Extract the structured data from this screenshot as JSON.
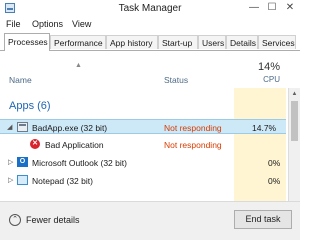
{
  "window": {
    "title": "Task Manager",
    "min": "—",
    "max": "☐",
    "close": "✕"
  },
  "menu": [
    "File",
    "Options",
    "View"
  ],
  "tabs": [
    "Processes",
    "Performance",
    "App history",
    "Start-up",
    "Users",
    "Details",
    "Services"
  ],
  "columns": {
    "name": "Name",
    "status": "Status",
    "cpu_percent": "14%",
    "cpu_label": "CPU"
  },
  "group": {
    "label": "Apps (6)"
  },
  "rows": [
    {
      "name": "BadApp.exe (32 bit)",
      "status": "Not responding",
      "cpu": "14.7%",
      "icon": "app-window-icon",
      "selected": true
    },
    {
      "name": "Bad Application",
      "status": "Not responding",
      "cpu": "",
      "icon": "error-icon",
      "child": true
    },
    {
      "name": "Microsoft Outlook (32 bit)",
      "status": "",
      "cpu": "0%",
      "icon": "outlook-icon"
    },
    {
      "name": "Notepad (32 bit)",
      "status": "",
      "cpu": "0%",
      "icon": "notepad-icon"
    }
  ],
  "footer": {
    "fewer_details": "Fewer details",
    "end_task": "End task"
  },
  "colors": {
    "accent": "#1e66b5",
    "not_responding": "#d83b01",
    "selection": "#cde8f6",
    "cpu_highlight": "#fff5d2"
  }
}
